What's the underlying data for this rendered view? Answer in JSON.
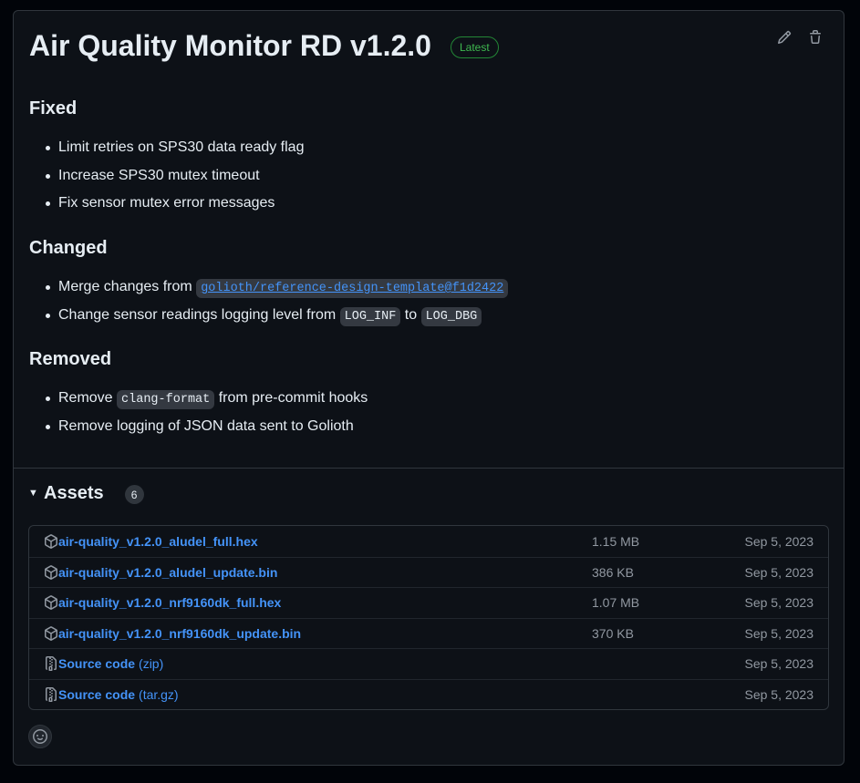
{
  "release": {
    "title": "Air Quality Monitor RD v1.2.0",
    "badge": "Latest"
  },
  "sections": {
    "fixed": {
      "heading": "Fixed",
      "items": [
        "Limit retries on SPS30 data ready flag",
        "Increase SPS30 mutex timeout",
        "Fix sensor mutex error messages"
      ]
    },
    "changed": {
      "heading": "Changed",
      "item1_prefix": "Merge changes from ",
      "item1_link": "golioth/reference-design-template@f1d2422",
      "item2_prefix": "Change sensor readings logging level from ",
      "item2_code1": "LOG_INF",
      "item2_mid": " to ",
      "item2_code2": "LOG_DBG"
    },
    "removed": {
      "heading": "Removed",
      "item1_prefix": "Remove ",
      "item1_code": "clang-format",
      "item1_suffix": " from pre-commit hooks",
      "item2": "Remove logging of JSON data sent to Golioth"
    }
  },
  "assets": {
    "title": "Assets",
    "count": "6",
    "rows": [
      {
        "name": "air-quality_v1.2.0_aludel_full.hex",
        "ext": "",
        "size": "1.15 MB",
        "date": "Sep 5, 2023",
        "icon": "package-icon"
      },
      {
        "name": "air-quality_v1.2.0_aludel_update.bin",
        "ext": "",
        "size": "386 KB",
        "date": "Sep 5, 2023",
        "icon": "package-icon"
      },
      {
        "name": "air-quality_v1.2.0_nrf9160dk_full.hex",
        "ext": "",
        "size": "1.07 MB",
        "date": "Sep 5, 2023",
        "icon": "package-icon"
      },
      {
        "name": "air-quality_v1.2.0_nrf9160dk_update.bin",
        "ext": "",
        "size": "370 KB",
        "date": "Sep 5, 2023",
        "icon": "package-icon"
      },
      {
        "name": "Source code",
        "ext": "(zip)",
        "size": "",
        "date": "Sep 5, 2023",
        "icon": "file-zip-icon"
      },
      {
        "name": "Source code",
        "ext": "(tar.gz)",
        "size": "",
        "date": "Sep 5, 2023",
        "icon": "file-zip-icon"
      }
    ]
  },
  "colors": {
    "background": "#0d1117",
    "border": "#30363d",
    "link": "#4493f8",
    "badge": "#3fb950",
    "muted": "#9198a1"
  }
}
